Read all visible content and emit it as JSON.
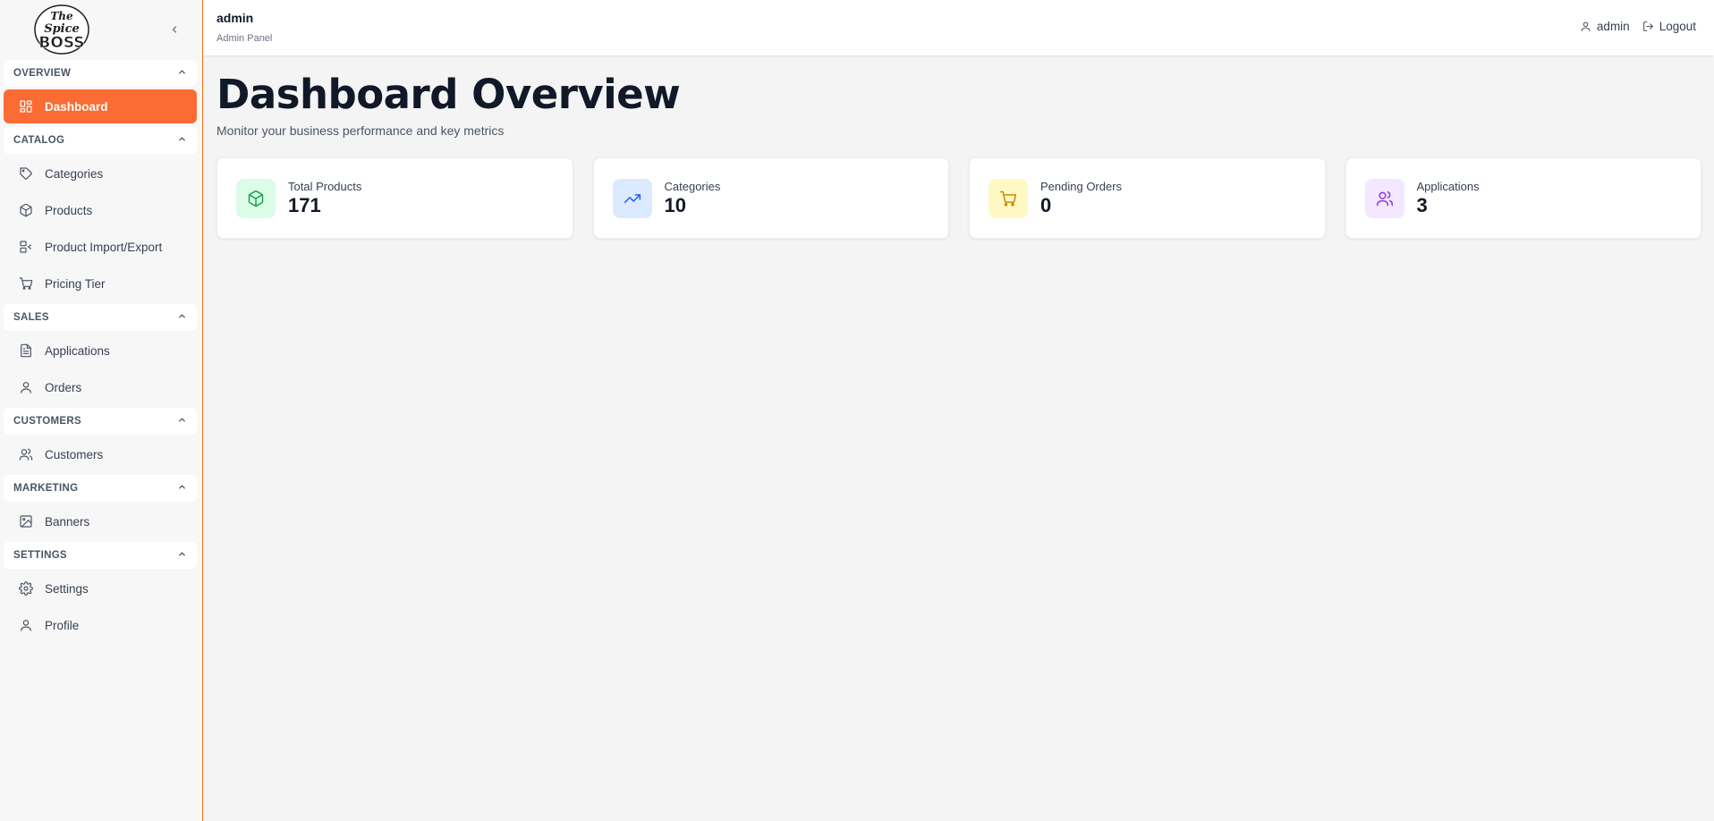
{
  "brand": {
    "logo_text": "The Spice BOSS"
  },
  "sidebar": {
    "sections": [
      {
        "title": "OVERVIEW",
        "items": [
          {
            "label": "Dashboard",
            "icon": "dashboard-icon",
            "active": true
          }
        ]
      },
      {
        "title": "CATALOG",
        "items": [
          {
            "label": "Categories",
            "icon": "tag-icon"
          },
          {
            "label": "Products",
            "icon": "box-icon"
          },
          {
            "label": "Product Import/Export",
            "icon": "import-export-icon"
          },
          {
            "label": "Pricing Tier",
            "icon": "cart-icon"
          }
        ]
      },
      {
        "title": "SALES",
        "items": [
          {
            "label": "Applications",
            "icon": "document-icon"
          },
          {
            "label": "Orders",
            "icon": "user-icon"
          }
        ]
      },
      {
        "title": "CUSTOMERS",
        "items": [
          {
            "label": "Customers",
            "icon": "users-icon"
          }
        ]
      },
      {
        "title": "MARKETING",
        "items": [
          {
            "label": "Banners",
            "icon": "image-icon"
          }
        ]
      },
      {
        "title": "SETTINGS",
        "items": [
          {
            "label": "Settings",
            "icon": "gear-icon"
          },
          {
            "label": "Profile",
            "icon": "user-icon"
          }
        ]
      }
    ]
  },
  "header": {
    "user": "admin",
    "subtitle": "Admin Panel",
    "account_label": "admin",
    "logout_label": "Logout"
  },
  "main": {
    "title": "Dashboard Overview",
    "subtitle": "Monitor your business performance and key metrics",
    "cards": [
      {
        "label": "Total Products",
        "value": "171",
        "icon": "box-icon",
        "bg": "#dcfce7",
        "color": "#16a34a"
      },
      {
        "label": "Categories",
        "value": "10",
        "icon": "trending-up-icon",
        "bg": "#dbeafe",
        "color": "#2563eb"
      },
      {
        "label": "Pending Orders",
        "value": "0",
        "icon": "cart-icon",
        "bg": "#fef9c3",
        "color": "#ca8a04"
      },
      {
        "label": "Applications",
        "value": "3",
        "icon": "users-icon",
        "bg": "#f3e8ff",
        "color": "#9333ea"
      }
    ]
  },
  "colors": {
    "accent": "#fb6b34",
    "sidebar_bg": "#f7f7f7",
    "page_bg": "#f4f4f5"
  }
}
